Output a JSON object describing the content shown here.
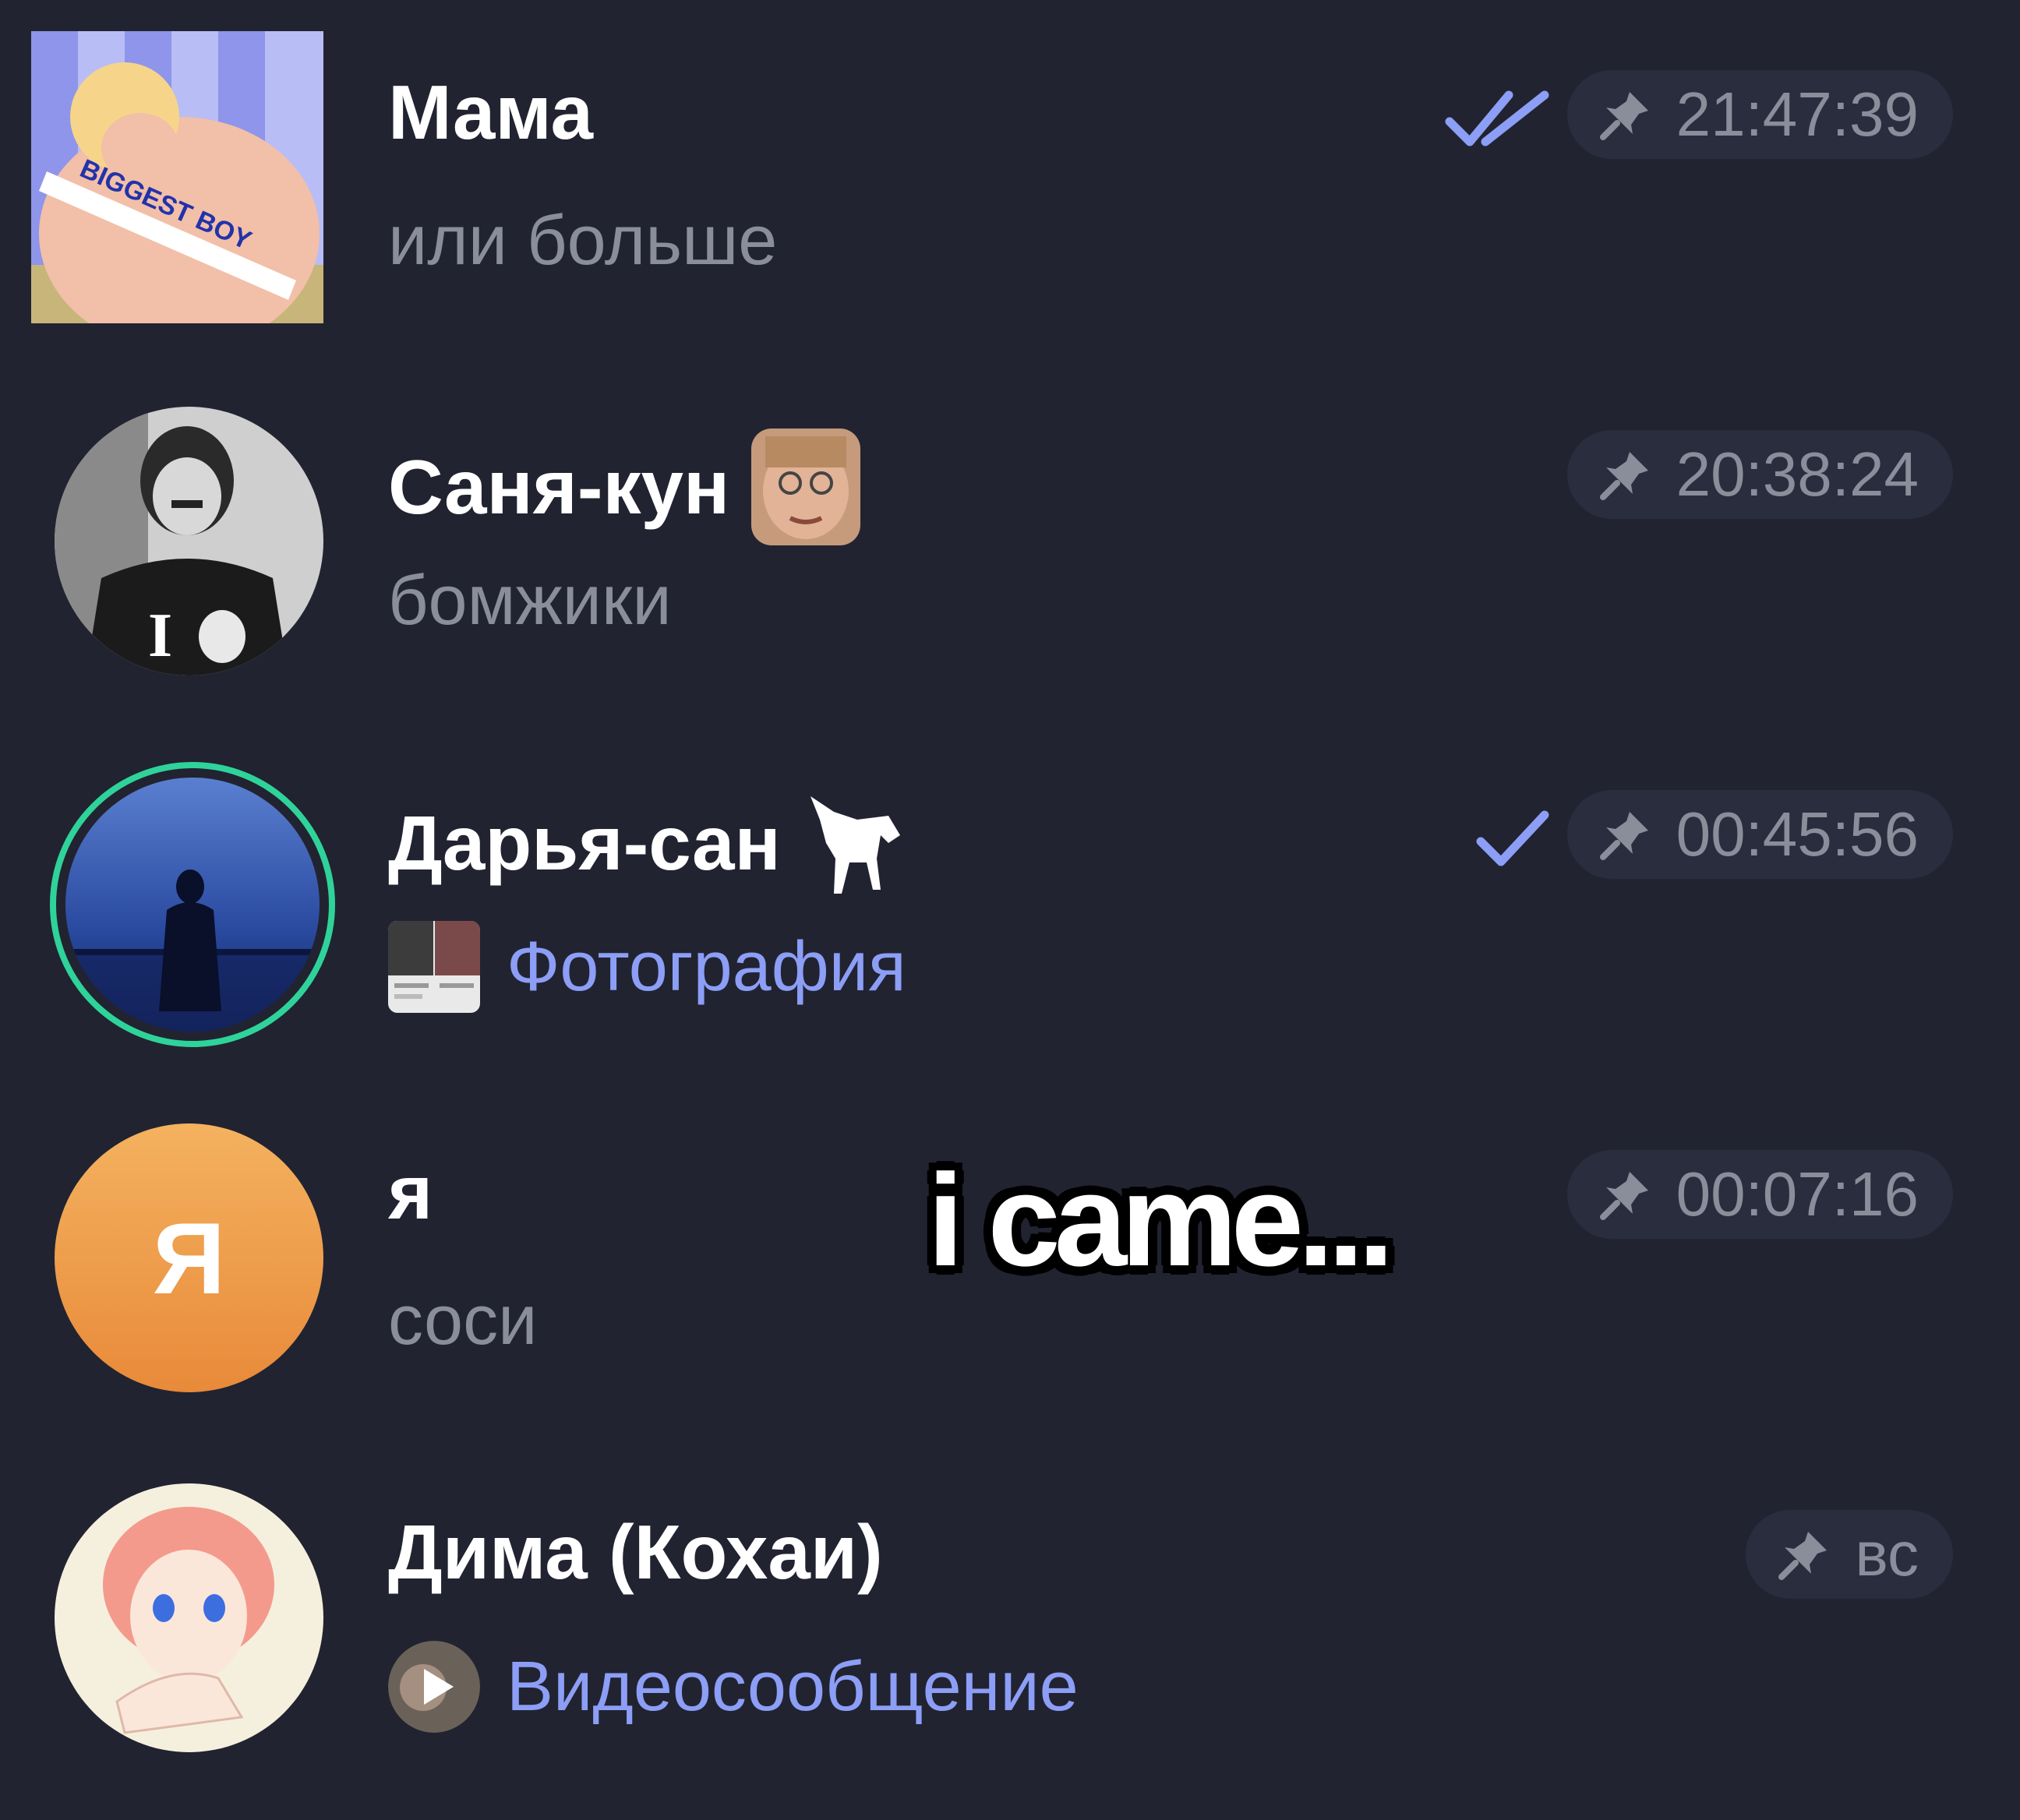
{
  "chats": [
    {
      "name": "Мама",
      "preview": "или больше",
      "time": "21:47:39",
      "status": "read"
    },
    {
      "name": "Саня-кун",
      "preview": "бомжики",
      "time": "20:38:24",
      "status": "none"
    },
    {
      "name": "Дарья-сан",
      "preview": "Фотография",
      "time": "00:45:56",
      "status": "sent"
    },
    {
      "name": "я",
      "preview": "соси",
      "time": "00:07:16",
      "status": "none",
      "avatar_letter": "Я"
    },
    {
      "name": "Дима (Кохаи)",
      "preview": "Видеосообщение",
      "time": "вс",
      "status": "none"
    }
  ],
  "overlay_caption": "i came...",
  "colors": {
    "background": "#212331",
    "accent": "#8c9ef5",
    "story_ring": "#2fd39a",
    "muted_text": "#8a8d9a",
    "avatar_letter_gradient": [
      "#f4b25f",
      "#e88a3a"
    ]
  },
  "icons": {
    "pin": "pin-icon",
    "read": "double-check-icon",
    "sent": "check-icon"
  }
}
